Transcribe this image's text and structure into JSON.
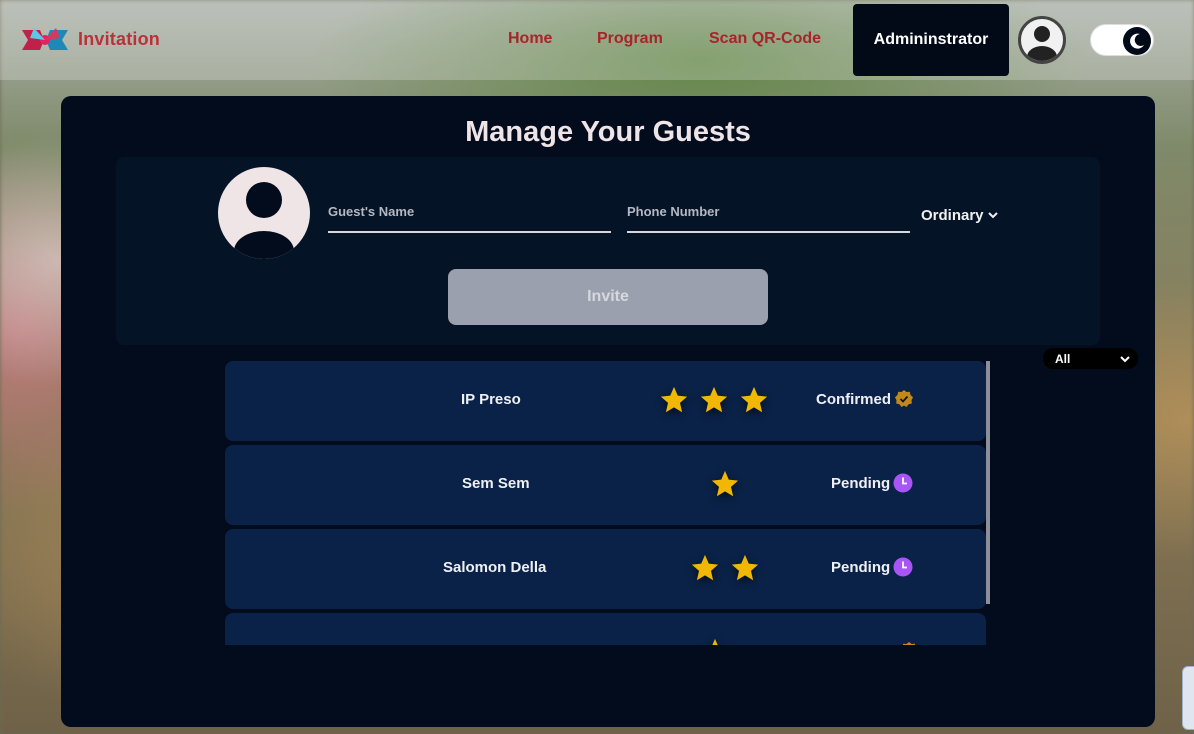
{
  "navbar": {
    "brand": "Invitation",
    "links": [
      "Home",
      "Program",
      "Scan QR-Code"
    ],
    "admin_label": "Admininstrator",
    "theme_toggle": "dark-mode",
    "colors": {
      "link": "#a8242a",
      "admin_bg": "#020a18"
    }
  },
  "page": {
    "title": "Manage Your Guests"
  },
  "form": {
    "name_placeholder": "Guest's Name",
    "phone_placeholder": "Phone Number",
    "guest_type": "Ordinary",
    "invite_label": "Invite"
  },
  "filter": {
    "selected": "All"
  },
  "guests": [
    {
      "name": "IP Preso",
      "stars": 3,
      "status": "Confirmed",
      "status_icon": "check-badge-icon",
      "status_color": "#c08a1a"
    },
    {
      "name": "Sem Sem",
      "stars": 1,
      "status": "Pending",
      "status_icon": "clock-icon",
      "status_color": "#a855f7"
    },
    {
      "name": "Salomon Della",
      "stars": 2,
      "status": "Pending",
      "status_icon": "clock-icon",
      "status_color": "#a855f7"
    },
    {
      "name": "",
      "stars": 1,
      "status": "",
      "status_icon": "check-badge-icon",
      "status_color": "#c08a1a"
    }
  ],
  "colors": {
    "panel": "#020c1c",
    "row": "#0a2247",
    "star": "#f2b705"
  }
}
